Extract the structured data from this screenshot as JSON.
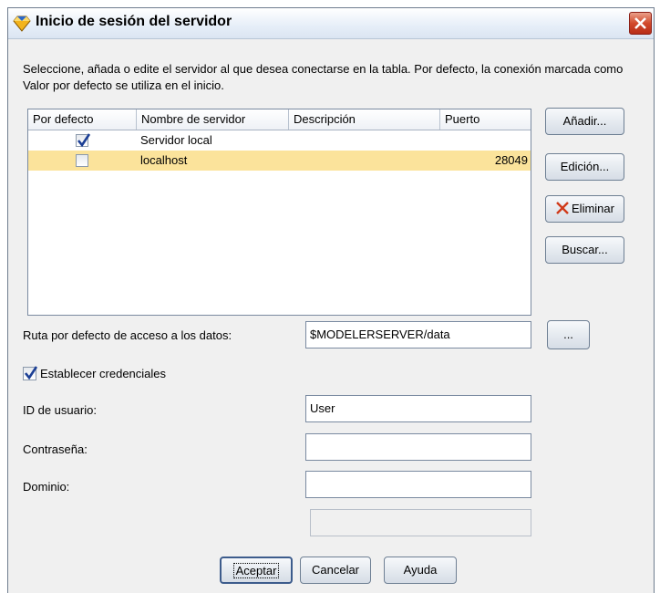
{
  "window": {
    "title": "Inicio de sesión del servidor"
  },
  "intro_text": "Seleccione, añada o edite el servidor al que desea conectarse en la tabla. Por defecto, la conexión marcada como Valor por defecto se utiliza en el inicio.",
  "table": {
    "columns": [
      "Por defecto",
      "Nombre de servidor",
      "Descripción",
      "Puerto"
    ],
    "rows": [
      {
        "default": true,
        "name": "Servidor local",
        "description": "",
        "port": ""
      },
      {
        "default": false,
        "name": "localhost",
        "description": "",
        "port": "28049"
      }
    ]
  },
  "side_buttons": {
    "add": "Añadir...",
    "edit": "Edición...",
    "delete": "Eliminar",
    "search": "Buscar..."
  },
  "data_path": {
    "label": "Ruta por defecto de acceso a los datos:",
    "value": "$MODELERSERVER/data",
    "browse": "..."
  },
  "credentials": {
    "label": "Establecer credenciales",
    "checked": true
  },
  "user_id": {
    "label": "ID de usuario:",
    "value": "User"
  },
  "password": {
    "label": "Contraseña:",
    "value": ""
  },
  "domain": {
    "label": "Dominio:",
    "value": ""
  },
  "footer": {
    "ok": "Aceptar",
    "cancel": "Cancelar",
    "help": "Ayuda"
  },
  "colors": {
    "selected_row": "#fbe39b",
    "delete_icon": "#d03a1a",
    "check": "#1c3f95"
  }
}
